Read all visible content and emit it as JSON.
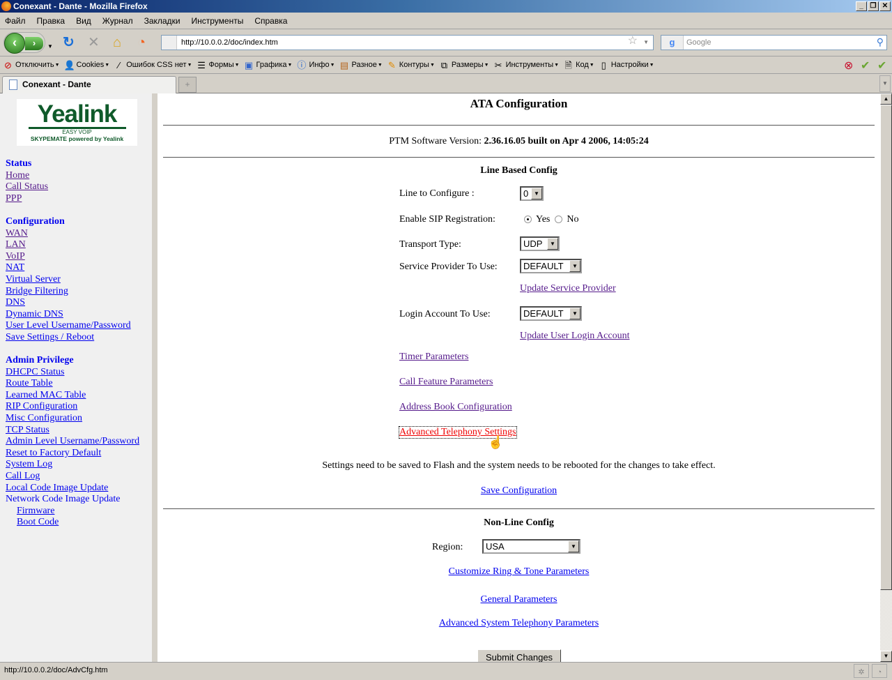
{
  "window": {
    "title": "Conexant - Dante - Mozilla Firefox"
  },
  "menu": [
    "Файл",
    "Правка",
    "Вид",
    "Журнал",
    "Закладки",
    "Инструменты",
    "Справка"
  ],
  "navbar": {
    "url": "http://10.0.0.2/doc/index.htm",
    "search_placeholder": "Google"
  },
  "devbar": [
    {
      "label": "Отключить",
      "icon": "no-entry-icon"
    },
    {
      "label": "Cookies",
      "icon": "user-icon"
    },
    {
      "label": "Ошибок CSS нет",
      "icon": "wand-icon"
    },
    {
      "label": "Формы",
      "icon": "form-icon"
    },
    {
      "label": "Графика",
      "icon": "image-icon"
    },
    {
      "label": "Инфо",
      "icon": "info-icon"
    },
    {
      "label": "Разное",
      "icon": "misc-icon"
    },
    {
      "label": "Контуры",
      "icon": "pencil-icon"
    },
    {
      "label": "Размеры",
      "icon": "resize-icon"
    },
    {
      "label": "Инструменты",
      "icon": "tools-icon"
    },
    {
      "label": "Код",
      "icon": "document-icon"
    },
    {
      "label": "Настройки",
      "icon": "settings-icon"
    }
  ],
  "tab": {
    "label": "Conexant - Dante"
  },
  "logo": {
    "brand": "Yealink",
    "tagline": "EASY VOIP",
    "sub": "SKYPEMATE powered by Yealink"
  },
  "sidebar": {
    "status": {
      "heading": "Status",
      "links": [
        "Home",
        "Call Status",
        "PPP"
      ]
    },
    "configuration": {
      "heading": "Configuration",
      "links": [
        "WAN",
        "LAN",
        "VoIP",
        "NAT",
        "Virtual Server",
        "Bridge Filtering",
        "DNS",
        "Dynamic DNS",
        "User Level Username/Password",
        "Save Settings / Reboot"
      ]
    },
    "admin": {
      "heading": "Admin Privilege",
      "links": [
        "DHCPC Status",
        "Route Table",
        "Learned MAC Table",
        "RIP Configuration",
        "Misc Configuration",
        "TCP Status",
        "Admin Level Username/Password",
        "Reset to Factory Default",
        "System Log",
        "Call Log",
        "Local Code Image Update"
      ],
      "network_label": "Network Code Image Update",
      "sub_links": [
        "Firmware",
        "Boot Code"
      ]
    }
  },
  "main": {
    "title": "ATA Configuration",
    "version_label": "PTM Software Version:",
    "version_value": "2.36.16.05 built on Apr 4 2006, 14:05:24",
    "line_heading": "Line Based Config",
    "line_label": "Line to Configure :",
    "line_value": "0",
    "sip_label": "Enable SIP Registration:",
    "sip_yes": "Yes",
    "sip_no": "No",
    "sip_selected": "Yes",
    "transport_label": "Transport Type:",
    "transport_value": "UDP",
    "provider_label": "Service Provider To Use:",
    "provider_value": "DEFAULT",
    "update_provider": "Update Service Provider",
    "login_label": "Login Account To Use:",
    "login_value": "DEFAULT",
    "update_login": "Update User Login Account",
    "timer": "Timer Parameters",
    "call_feature": "Call Feature Parameters",
    "address_book": "Address Book Configuration",
    "advanced_telephony": "Advanced Telephony Settings",
    "notice": "Settings need to be saved to Flash and the system needs to be rebooted for the changes to take effect.",
    "save_config": "Save Configuration",
    "nonline_heading": "Non-Line Config",
    "region_label": "Region:",
    "region_value": "USA",
    "ring_tone": "Customize Ring & Tone Parameters",
    "general": "General Parameters",
    "adv_system": "Advanced System Telephony Parameters",
    "submit": "Submit Changes"
  },
  "status": {
    "text": "http://10.0.0.2/doc/AdvCfg.htm"
  }
}
